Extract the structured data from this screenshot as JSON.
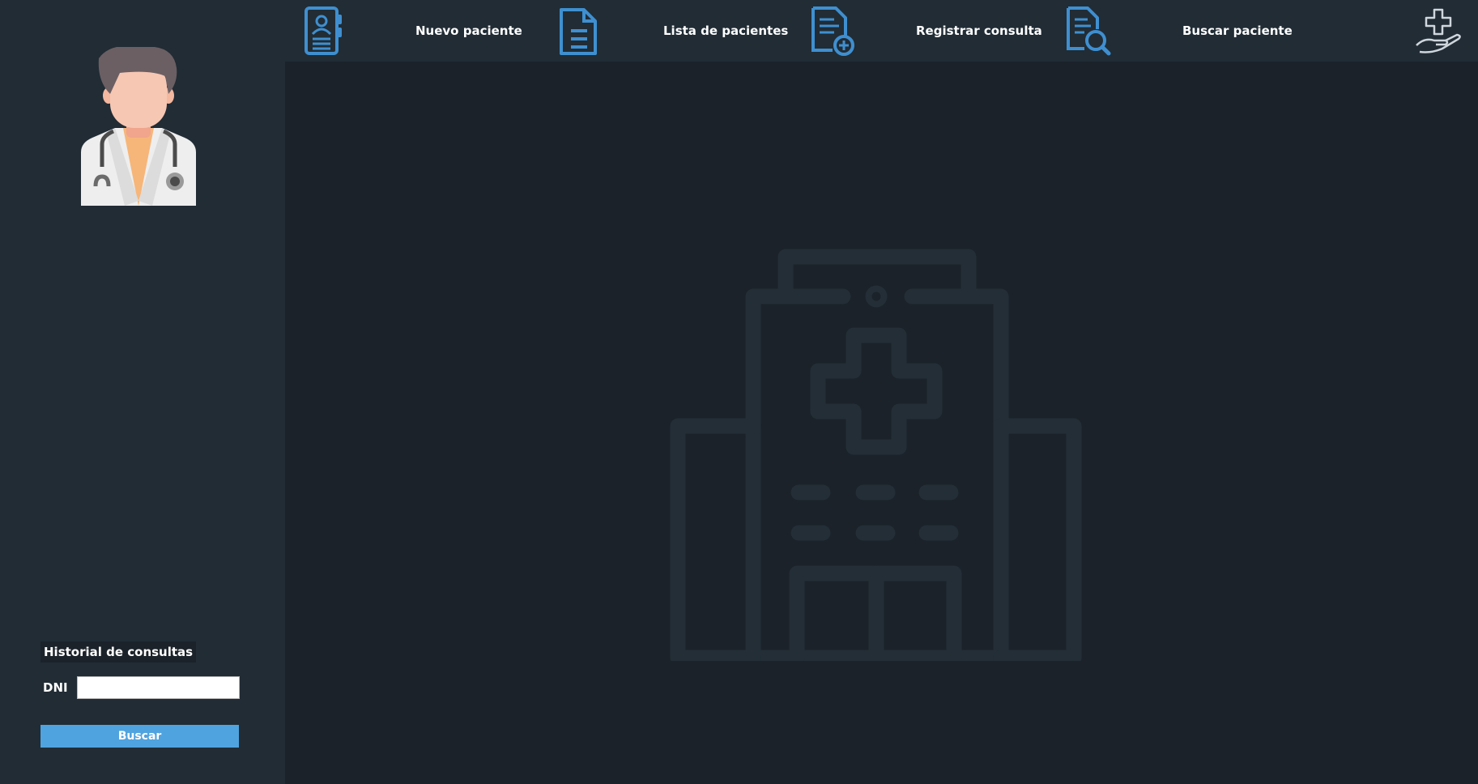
{
  "nav": {
    "items": [
      {
        "label": "Nuevo paciente",
        "icon": "patient-record-icon"
      },
      {
        "label": "Lista de pacientes",
        "icon": "document-list-icon"
      },
      {
        "label": "Registrar consulta",
        "icon": "add-consultation-icon"
      },
      {
        "label": "Buscar paciente",
        "icon": "search-document-icon"
      }
    ],
    "brand_icon": "medical-care-hand-icon"
  },
  "sidebar": {
    "avatar_icon": "doctor-avatar-icon",
    "history": {
      "title": "Historial de consultas",
      "dni_label": "DNI",
      "dni_value": "",
      "search_label": "Buscar"
    }
  },
  "main": {
    "background_icon": "hospital-building-icon"
  },
  "colors": {
    "sidebar_bg": "#212c35",
    "main_bg": "#1b2229",
    "accent": "#4fa3df",
    "icon_blue": "#3f8fd0"
  }
}
